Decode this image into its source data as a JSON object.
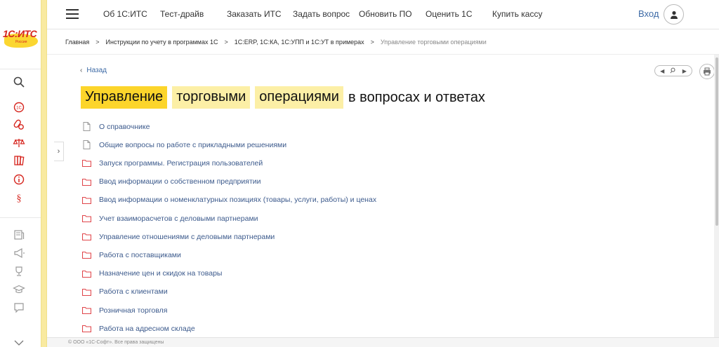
{
  "logo": {
    "text": "1С:ИТС",
    "sub": "Россия"
  },
  "topnav": {
    "items": [
      {
        "label": "Об 1С:ИТС"
      },
      {
        "label": "Тест-драйв"
      },
      {
        "label": "Заказать ИТС"
      },
      {
        "label": "Задать вопрос"
      },
      {
        "label": "Обновить ПО"
      },
      {
        "label": "Оценить 1С"
      },
      {
        "label": "Купить кассу"
      }
    ],
    "login_label": "Вход"
  },
  "breadcrumb": [
    {
      "label": "Главная"
    },
    {
      "label": "Инструкции по учету в программах 1С"
    },
    {
      "label": "1С:ERP, 1С:КА, 1С:УПП и 1С:УТ в примерах"
    },
    {
      "label": "Управление торговыми операциями"
    }
  ],
  "back_label": "Назад",
  "title": {
    "word1": "Управление",
    "word2": "торговыми",
    "word3": "операциями",
    "tail": "в вопросах и ответах"
  },
  "items": [
    {
      "label": "О справочнике",
      "icon": "document-icon"
    },
    {
      "label": "Общие вопросы по работе с прикладными решениями",
      "icon": "document-icon"
    },
    {
      "label": "Запуск программы. Регистрация пользователей",
      "icon": "folder-icon"
    },
    {
      "label": "Ввод информации о собственном предприятии",
      "icon": "folder-icon"
    },
    {
      "label": "Ввод информации о номенклатурных позициях (товары, услуги, работы) и ценах",
      "icon": "folder-icon"
    },
    {
      "label": "Учет взаиморасчетов с деловыми партнерами",
      "icon": "folder-icon"
    },
    {
      "label": "Управление отношениями с деловыми партнерами",
      "icon": "folder-icon"
    },
    {
      "label": "Работа с поставщиками",
      "icon": "folder-icon"
    },
    {
      "label": "Назначение цен и скидок на товары",
      "icon": "folder-icon"
    },
    {
      "label": "Работа с клиентами",
      "icon": "folder-icon"
    },
    {
      "label": "Розничная торговля",
      "icon": "folder-icon"
    },
    {
      "label": "Работа на адресном складе",
      "icon": "folder-icon"
    }
  ],
  "footer": "© ООО «1С-Софт». Все права защищены",
  "colors": {
    "accent_yellow": "#fcd52b",
    "highlight_light": "#fcefa6",
    "link": "#3c5a8c",
    "brand_red": "#d6251e"
  }
}
